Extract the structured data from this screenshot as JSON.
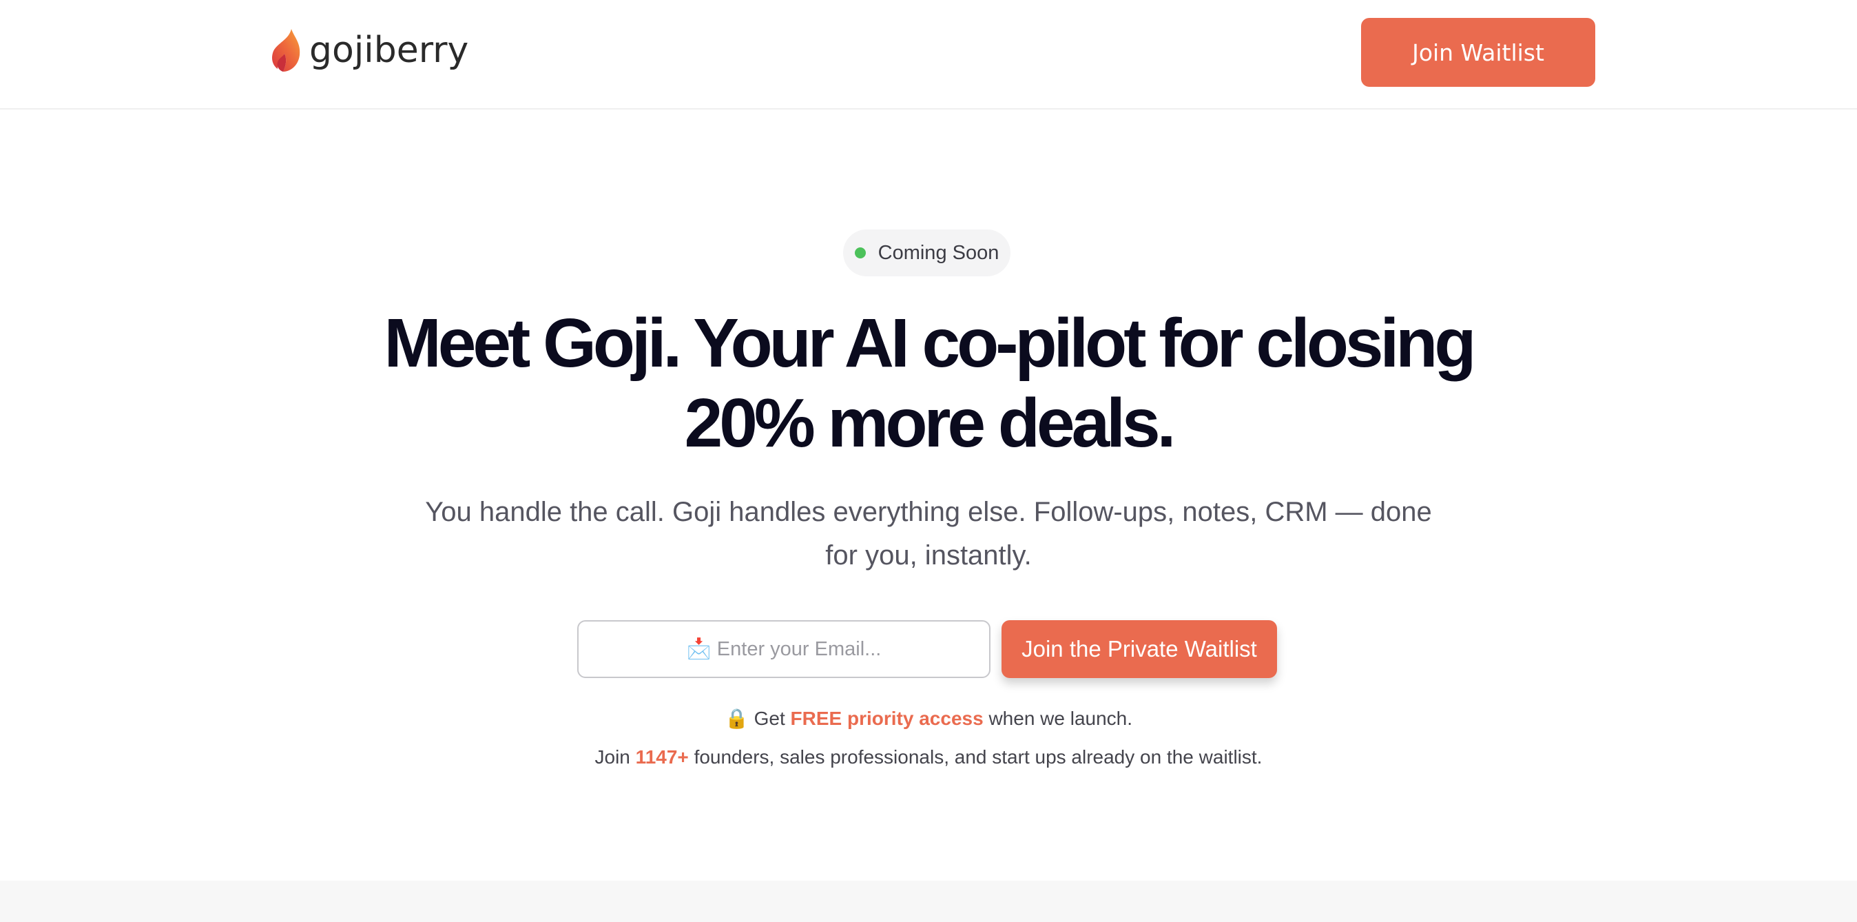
{
  "brand": {
    "name": "gojiberry",
    "logo_icon": "flame-icon",
    "accent_color": "#ea6b4f"
  },
  "header": {
    "cta_label": "Join Waitlist"
  },
  "hero": {
    "badge": {
      "label": "Coming Soon",
      "dot_color": "#4cc15a"
    },
    "headline_line1": "Meet Goji. Your AI co-pilot for closing",
    "headline_line2": "20% more deals.",
    "subhead_line1": "You handle the call. Goji handles everything else. Follow-ups, notes, CRM — done",
    "subhead_line2": "for you, instantly."
  },
  "signup": {
    "email_placeholder": "📩 Enter your Email...",
    "submit_label": "Join the Private Waitlist"
  },
  "notes": {
    "line1": {
      "icon": "🔒",
      "prefix": "Get",
      "highlight": "FREE priority access",
      "suffix": "when we launch."
    },
    "line2": {
      "prefix": "Join",
      "count": "1147+",
      "suffix": "founders, sales professionals, and start ups already on the waitlist."
    }
  }
}
